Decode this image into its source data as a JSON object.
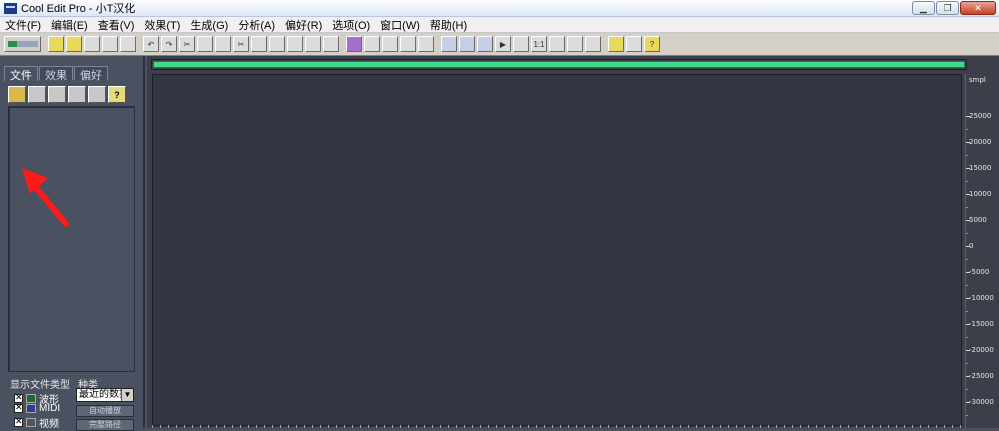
{
  "window": {
    "title": "Cool Edit Pro  - 小T汉化",
    "controls": [
      "minimize",
      "restore",
      "close"
    ]
  },
  "menu": [
    "文件(F)",
    "编辑(E)",
    "查看(V)",
    "效果(T)",
    "生成(G)",
    "分析(A)",
    "偏好(R)",
    "选项(O)",
    "窗口(W)",
    "帮助(H)"
  ],
  "left_panel": {
    "tabs": [
      "文件",
      "效果",
      "偏好"
    ],
    "active_tab": "文件",
    "toolbar_icons": [
      "open-file-icon",
      "close-file-icon",
      "insert-icon",
      "insert-multitrack-icon",
      "options-icon",
      "help-icon"
    ],
    "show_types_label": "显示文件类型",
    "sort_label": "种类",
    "file_types": [
      {
        "label": "波形",
        "checked": true,
        "icon": "waveform-icon"
      },
      {
        "label": "MIDI",
        "checked": true,
        "icon": "midi-icon"
      },
      {
        "label": "视频",
        "checked": true,
        "icon": "video-icon"
      }
    ],
    "sort_value": "最近的数排",
    "buttons": [
      "自动播放",
      "完整路径"
    ]
  },
  "ruler": {
    "unit": "smpl",
    "labels": [
      "25000",
      "20000",
      "15000",
      "10000",
      "5000",
      "0",
      "-5000",
      "-10000",
      "-15000",
      "-20000",
      "-25000",
      "-30000"
    ]
  },
  "colors": {
    "overview": "#41d98a",
    "background": "#333640",
    "panel": "#4a5160"
  }
}
